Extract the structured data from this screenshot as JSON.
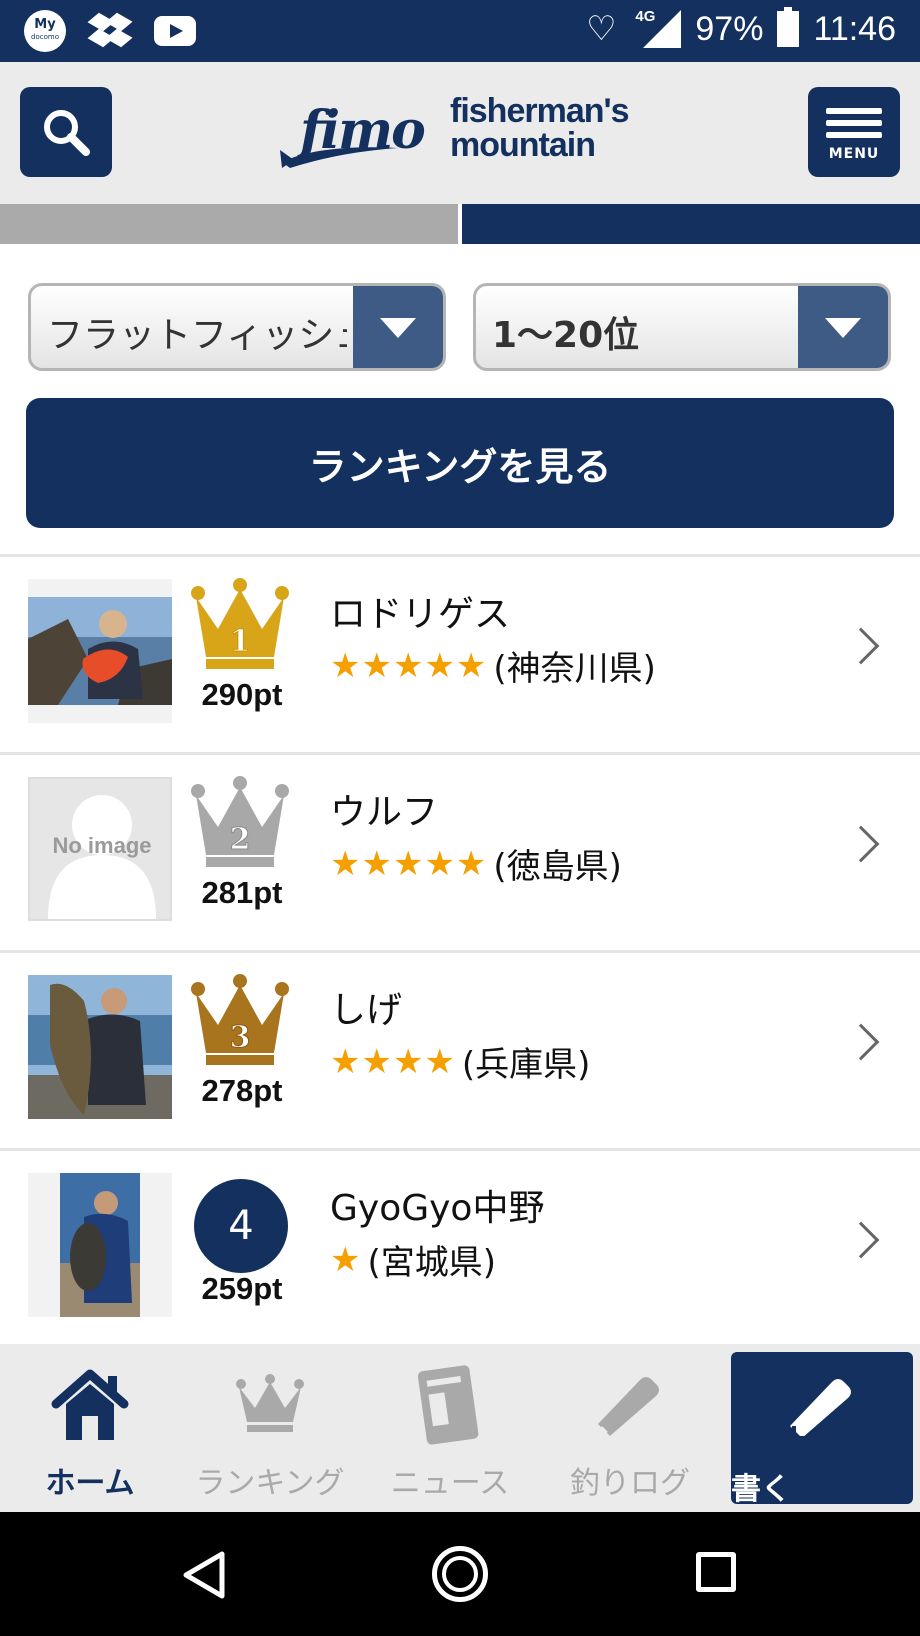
{
  "status_bar": {
    "my_label": "My",
    "docomo_label": "docomo",
    "network": "4G",
    "battery": "97%",
    "time": "11:46"
  },
  "header": {
    "logo_brand": "fimo",
    "logo_line1": "fisherman's",
    "logo_line2": "mountain",
    "menu_label": "MENU"
  },
  "filters": {
    "species_value": "フラットフィッシュ",
    "range_value": "1〜20位",
    "view_button": "ランキングを見る"
  },
  "ranking": [
    {
      "rank": 1,
      "name": "ロドリゲス",
      "points": "290pt",
      "stars": "★★★★★",
      "star_count": 5,
      "prefecture": "(神奈川県)",
      "crown": "gold"
    },
    {
      "rank": 2,
      "name": "ウルフ",
      "points": "281pt",
      "stars": "★★★★★",
      "star_count": 5,
      "prefecture": "(徳島県)",
      "crown": "silver",
      "thumb_text": "No image"
    },
    {
      "rank": 3,
      "name": "しげ",
      "points": "278pt",
      "stars": "★★★★",
      "star_count": 4,
      "prefecture": "(兵庫県)",
      "crown": "bronze"
    },
    {
      "rank": 4,
      "name": "GyoGyo中野",
      "points": "259pt",
      "stars": "★",
      "star_count": 1,
      "prefecture": "(宮城県)",
      "rank_label": "4"
    }
  ],
  "bottom_nav": {
    "home": "ホーム",
    "ranking": "ランキング",
    "news": "ニュース",
    "log": "釣りログ",
    "write": "書く"
  },
  "colors": {
    "navy": "#13305f",
    "gold": "#d8a418",
    "silver": "#a8a8a8",
    "bronze": "#a8741e",
    "star": "#f5a000"
  }
}
